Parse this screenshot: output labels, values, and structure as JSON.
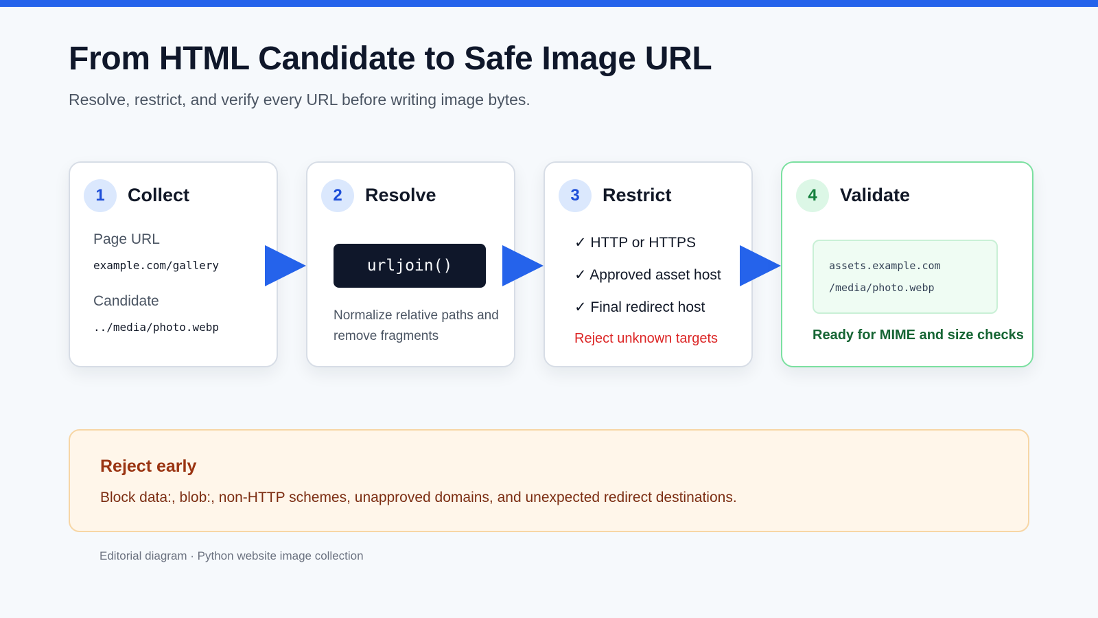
{
  "header": {
    "title": "From HTML Candidate to Safe Image URL",
    "subtitle": "Resolve, restrict, and verify every URL before writing image bytes."
  },
  "steps": [
    {
      "number": "1",
      "title": "Collect",
      "page_url_label": "Page URL",
      "page_url_value": "example.com/gallery",
      "candidate_label": "Candidate",
      "candidate_value": "../media/photo.webp"
    },
    {
      "number": "2",
      "title": "Resolve",
      "code": "urljoin()",
      "description": "Normalize relative paths and remove fragments"
    },
    {
      "number": "3",
      "title": "Restrict",
      "checks": [
        "✓ HTTP or HTTPS",
        "✓ Approved asset host",
        "✓ Final redirect host"
      ],
      "reject": "Reject unknown targets"
    },
    {
      "number": "4",
      "title": "Validate",
      "host": "assets.example.com",
      "path": "/media/photo.webp",
      "result": "Ready for MIME and size checks"
    }
  ],
  "notice": {
    "title": "Reject early",
    "text": "Block data:, blob:, non-HTTP schemes, unapproved domains, and unexpected redirect destinations."
  },
  "footer": "Editorial diagram · Python website image collection",
  "colors": {
    "accent": "#2563eb",
    "success": "#15803d",
    "danger": "#dc2626",
    "warning": "#9a3412"
  }
}
